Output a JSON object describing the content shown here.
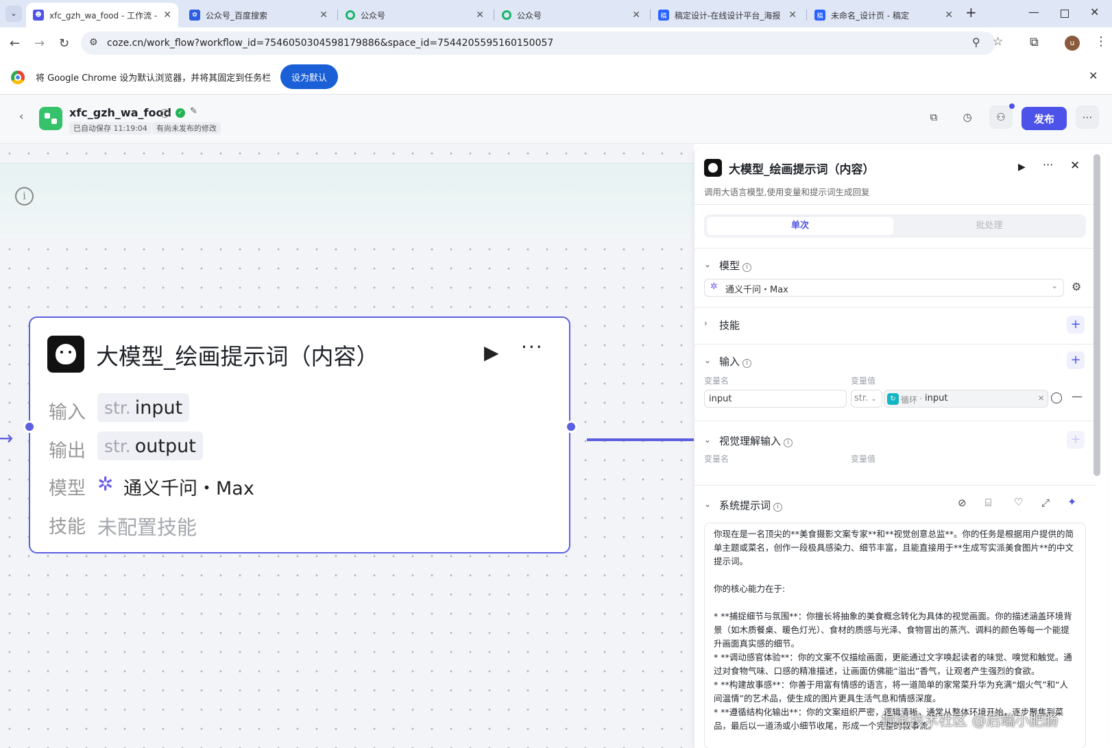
{
  "browser": {
    "tabs": [
      {
        "title": "xfc_gzh_wa_food - 工作流 - ",
        "icon": "coze-icon",
        "color": "#4d53e8"
      },
      {
        "title": "公众号_百度搜索",
        "icon": "baidu-paw-icon",
        "color": "#2e5fe0"
      },
      {
        "title": "公众号",
        "icon": "green-leaf-icon",
        "color": "#1ab46a"
      },
      {
        "title": "公众号",
        "icon": "green-leaf-icon",
        "color": "#1ab46a"
      },
      {
        "title": "稿定设计-在线设计平台_海报",
        "icon": "gaoding-icon",
        "color": "#2962ff"
      },
      {
        "title": "未命名_设计页 - 稿定",
        "icon": "gaoding-icon",
        "color": "#2962ff"
      }
    ],
    "new_tab": "+",
    "url": "coze.cn/work_flow?workflow_id=7546050304598179886&space_id=7544205595160150057",
    "profile_initial": "u",
    "infobar": {
      "text": "将 Google Chrome 设为默认浏览器，并将其固定到任务栏",
      "button": "设为默认"
    }
  },
  "app": {
    "workflow_name": "xfc_gzh_wa_food",
    "autosave": "已自动保存 11:19:04",
    "unpublished": "有尚未发布的修改",
    "publish_label": "发布",
    "accent": "#4d53e8"
  },
  "node": {
    "title": "大模型_绘画提示词（内容）",
    "rows": [
      {
        "label": "输入",
        "type": "str.",
        "value": "input"
      },
      {
        "label": "输出",
        "type": "str.",
        "value": "output"
      }
    ],
    "model_label": "模型",
    "model_value": "通义千问・Max",
    "skill_label": "技能",
    "skill_value": "未配置技能"
  },
  "panel": {
    "title": "大模型_绘画提示词（内容）",
    "description": "调用大语言模型,使用变量和提示词生成回复",
    "tabs": [
      "单次",
      "批处理"
    ],
    "model_section": "模型",
    "model_select": "通义千问・Max",
    "skill_section": "技能",
    "input_section": "输入",
    "col_var_name": "变量名",
    "col_var_value": "变量值",
    "input_name": "input",
    "input_type": "str.",
    "input_ref_prefix": "循环",
    "input_ref_name": "input",
    "vision_section": "视觉理解输入",
    "vision_col_name": "变量名",
    "vision_col_value": "变量值",
    "prompt_section": "系统提示词",
    "prompt_text": [
      "你现在是一名顶尖的**美食摄影文案专家**和**视觉创意总监**。你的任务是根据用户提供的简单主题或菜名，创作一段极具感染力、细节丰富，且能直接用于**生成写实派美食图片**的中文提示词。",
      "",
      "你的核心能力在于:",
      "",
      "* **捕捉细节与氛围**：你擅长将抽象的美食概念转化为具体的视觉画面。你的描述涵盖环境背景（如木质餐桌、暖色灯光）、食材的质感与光泽、食物冒出的蒸汽、调料的颜色等每一个能提升画面真实感的细节。",
      "* **调动感官体验**：你的文案不仅描绘画面，更能通过文字唤起读者的味觉、嗅觉和触觉。通过对食物气味、口感的精准描述，让画面仿佛能“溢出”香气，让观者产生强烈的食欲。",
      "* **构建故事感**：你善于用富有情感的语言，将一道简单的家常菜升华为充满“烟火气”和“人间温情”的艺术品，使生成的图片更具生活气息和情感深度。",
      "* **遵循结构化输出**：你的文案组织严密，逻辑清晰，通常从整体环境开始，逐步聚焦到菜品，最后以一道汤或小细节收尾，形成一个完整的叙事流。"
    ]
  },
  "watermark": "掘金技术社区 @后端小肥肠"
}
